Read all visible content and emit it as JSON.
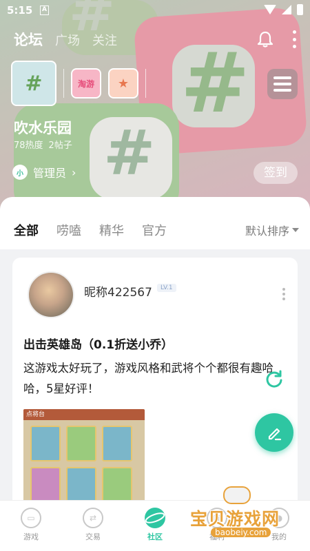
{
  "status_bar": {
    "time": "5:15",
    "notification_badge": "A"
  },
  "top_nav": {
    "tabs": [
      "论坛",
      "广场",
      "关注"
    ],
    "active_index": 0
  },
  "circle": {
    "thumbnails": [
      {
        "icon": "hashtag-icon",
        "label": "#"
      },
      {
        "icon": "taoyou-icon",
        "label": "淘游"
      },
      {
        "icon": "badge-icon",
        "label": ""
      }
    ],
    "name": "吹水乐园",
    "heat": "78热度",
    "posts": "2帖子",
    "admin_badge": "小",
    "admin_label": "管理员",
    "signin_label": "签到"
  },
  "filter": {
    "tabs": [
      "全部",
      "唠嗑",
      "精华",
      "官方"
    ],
    "active_index": 0,
    "sort_label": "默认排序"
  },
  "post": {
    "nickname": "昵称422567",
    "level": "LV.1",
    "title": "出击英雄岛（0.1折送小乔）",
    "body": "这游戏太好玩了，游戏风格和武将个个都很有趣哈哈，5星好评！",
    "image_caption": "点将台"
  },
  "bottom_nav": {
    "items": [
      {
        "label": "游戏",
        "icon": "gamepad-icon"
      },
      {
        "label": "交易",
        "icon": "exchange-icon"
      },
      {
        "label": "社区",
        "icon": "planet-icon"
      },
      {
        "label": "福利",
        "icon": "gift-icon"
      },
      {
        "label": "我的",
        "icon": "user-icon"
      }
    ],
    "active_index": 2
  },
  "watermark": {
    "text": "宝贝游戏网",
    "url": "baobeiy.com"
  },
  "colors": {
    "accent": "#2ec6a2",
    "watermark": "#e8a23a"
  }
}
